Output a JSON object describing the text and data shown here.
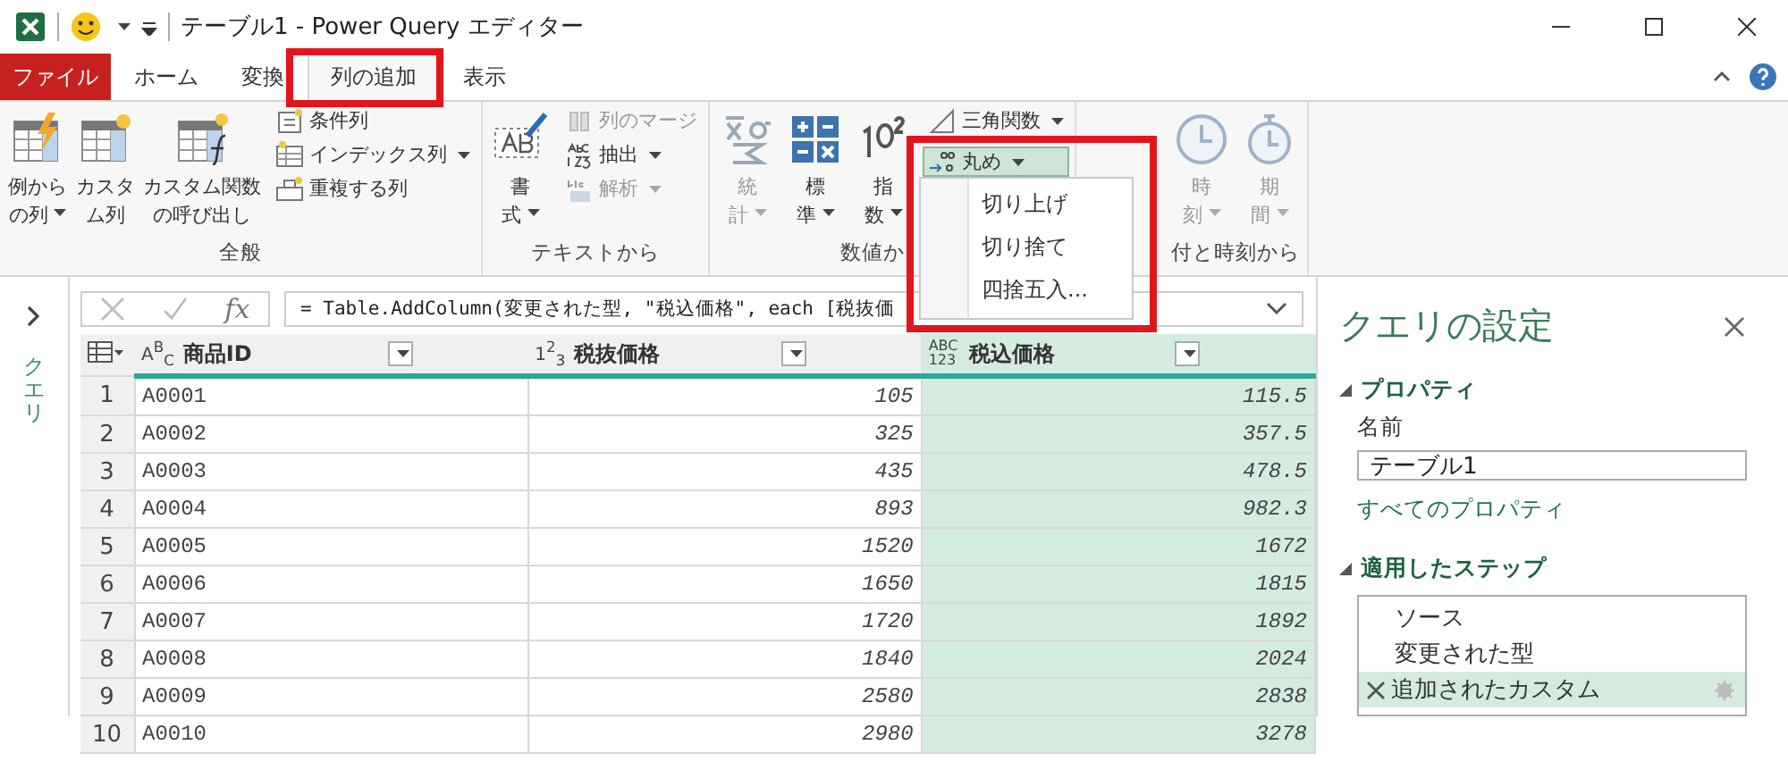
{
  "window": {
    "title": "テーブル1 - Power Query エディター"
  },
  "tabs": [
    {
      "label": "ファイル",
      "kind": "file",
      "selected": false
    },
    {
      "label": "ホーム",
      "kind": "tab",
      "selected": false
    },
    {
      "label": "変換",
      "kind": "tab",
      "selected": false
    },
    {
      "label": "列の追加",
      "kind": "tab",
      "selected": true
    },
    {
      "label": "表示",
      "kind": "tab",
      "selected": false
    }
  ],
  "ribbon": {
    "groups": [
      {
        "label": "全般",
        "large": [
          {
            "lines": [
              "例から",
              "の列"
            ],
            "dropdown": true,
            "disabled": false
          },
          {
            "lines": [
              "カスタ",
              "ム列"
            ],
            "dropdown": false,
            "disabled": false
          },
          {
            "lines": [
              "カスタム関数",
              "の呼び出し"
            ],
            "dropdown": false,
            "disabled": false
          }
        ],
        "small": [
          {
            "label": "条件列",
            "dropdown": false,
            "disabled": false,
            "selected": false
          },
          {
            "label": "インデックス列",
            "dropdown": true,
            "disabled": false,
            "selected": false
          },
          {
            "label": "重複する列",
            "dropdown": false,
            "disabled": false,
            "selected": false
          }
        ]
      },
      {
        "label": "テキストから",
        "large": [
          {
            "lines": [
              "書",
              "式"
            ],
            "dropdown": true,
            "disabled": false
          }
        ],
        "small": [
          {
            "label": "列のマージ",
            "dropdown": false,
            "disabled": true,
            "selected": false
          },
          {
            "label": "抽出",
            "dropdown": true,
            "disabled": false,
            "selected": false
          },
          {
            "label": "解析",
            "dropdown": true,
            "disabled": true,
            "selected": false
          }
        ]
      },
      {
        "label": "数値か",
        "large": [
          {
            "lines": [
              "統",
              "計"
            ],
            "dropdown": true,
            "disabled": true
          },
          {
            "lines": [
              "標",
              "準"
            ],
            "dropdown": true,
            "disabled": false
          },
          {
            "lines": [
              "指",
              "数"
            ],
            "dropdown": true,
            "disabled": false
          }
        ],
        "small": [
          {
            "label": "三角関数",
            "dropdown": true,
            "disabled": false,
            "selected": false
          },
          {
            "label": "丸め",
            "dropdown": true,
            "disabled": false,
            "selected": true
          }
        ]
      },
      {
        "label": "付と時刻から",
        "large": [
          {
            "lines": [
              "時",
              "刻"
            ],
            "dropdown": true,
            "disabled": true
          },
          {
            "lines": [
              "期",
              "間"
            ],
            "dropdown": true,
            "disabled": true
          }
        ]
      }
    ]
  },
  "rounding_menu": {
    "items": [
      "切り上げ",
      "切り捨て",
      "四捨五入..."
    ]
  },
  "query_rail": {
    "label": "クエリ"
  },
  "formula_bar": {
    "fx": "fx",
    "formula": "= Table.AddColumn(変更された型, \"税込価格\", each [税抜価"
  },
  "table": {
    "columns": [
      {
        "type": "A$^{B}$$_{C}$",
        "name": "商品ID",
        "kind": "text",
        "selected": false
      },
      {
        "type": "1$^{2}$$_{3}$",
        "name": "税抜価格",
        "kind": "number",
        "selected": false
      },
      {
        "type": "ABC 123",
        "name": "税込価格",
        "kind": "any",
        "selected": true
      }
    ],
    "rows": [
      {
        "index": "1",
        "cells": [
          "A0001",
          "105",
          "115.5"
        ]
      },
      {
        "index": "2",
        "cells": [
          "A0002",
          "325",
          "357.5"
        ]
      },
      {
        "index": "3",
        "cells": [
          "A0003",
          "435",
          "478.5"
        ]
      },
      {
        "index": "4",
        "cells": [
          "A0004",
          "893",
          "982.3"
        ]
      },
      {
        "index": "5",
        "cells": [
          "A0005",
          "1520",
          "1672"
        ]
      },
      {
        "index": "6",
        "cells": [
          "A0006",
          "1650",
          "1815"
        ]
      },
      {
        "index": "7",
        "cells": [
          "A0007",
          "1720",
          "1892"
        ]
      },
      {
        "index": "8",
        "cells": [
          "A0008",
          "1840",
          "2024"
        ]
      },
      {
        "index": "9",
        "cells": [
          "A0009",
          "2580",
          "2838"
        ]
      },
      {
        "index": "10",
        "cells": [
          "A0010",
          "2980",
          "3278"
        ]
      }
    ]
  },
  "settings": {
    "title": "クエリの設定",
    "properties": {
      "heading": "プロパティ",
      "name_label": "名前",
      "name_value": "テーブル1",
      "all_properties": "すべてのプロパティ"
    },
    "steps_heading": "適用したステップ",
    "steps": [
      {
        "label": "ソース",
        "selected": false
      },
      {
        "label": "変更された型",
        "selected": false
      },
      {
        "label": "追加されたカスタム",
        "selected": true
      }
    ]
  }
}
